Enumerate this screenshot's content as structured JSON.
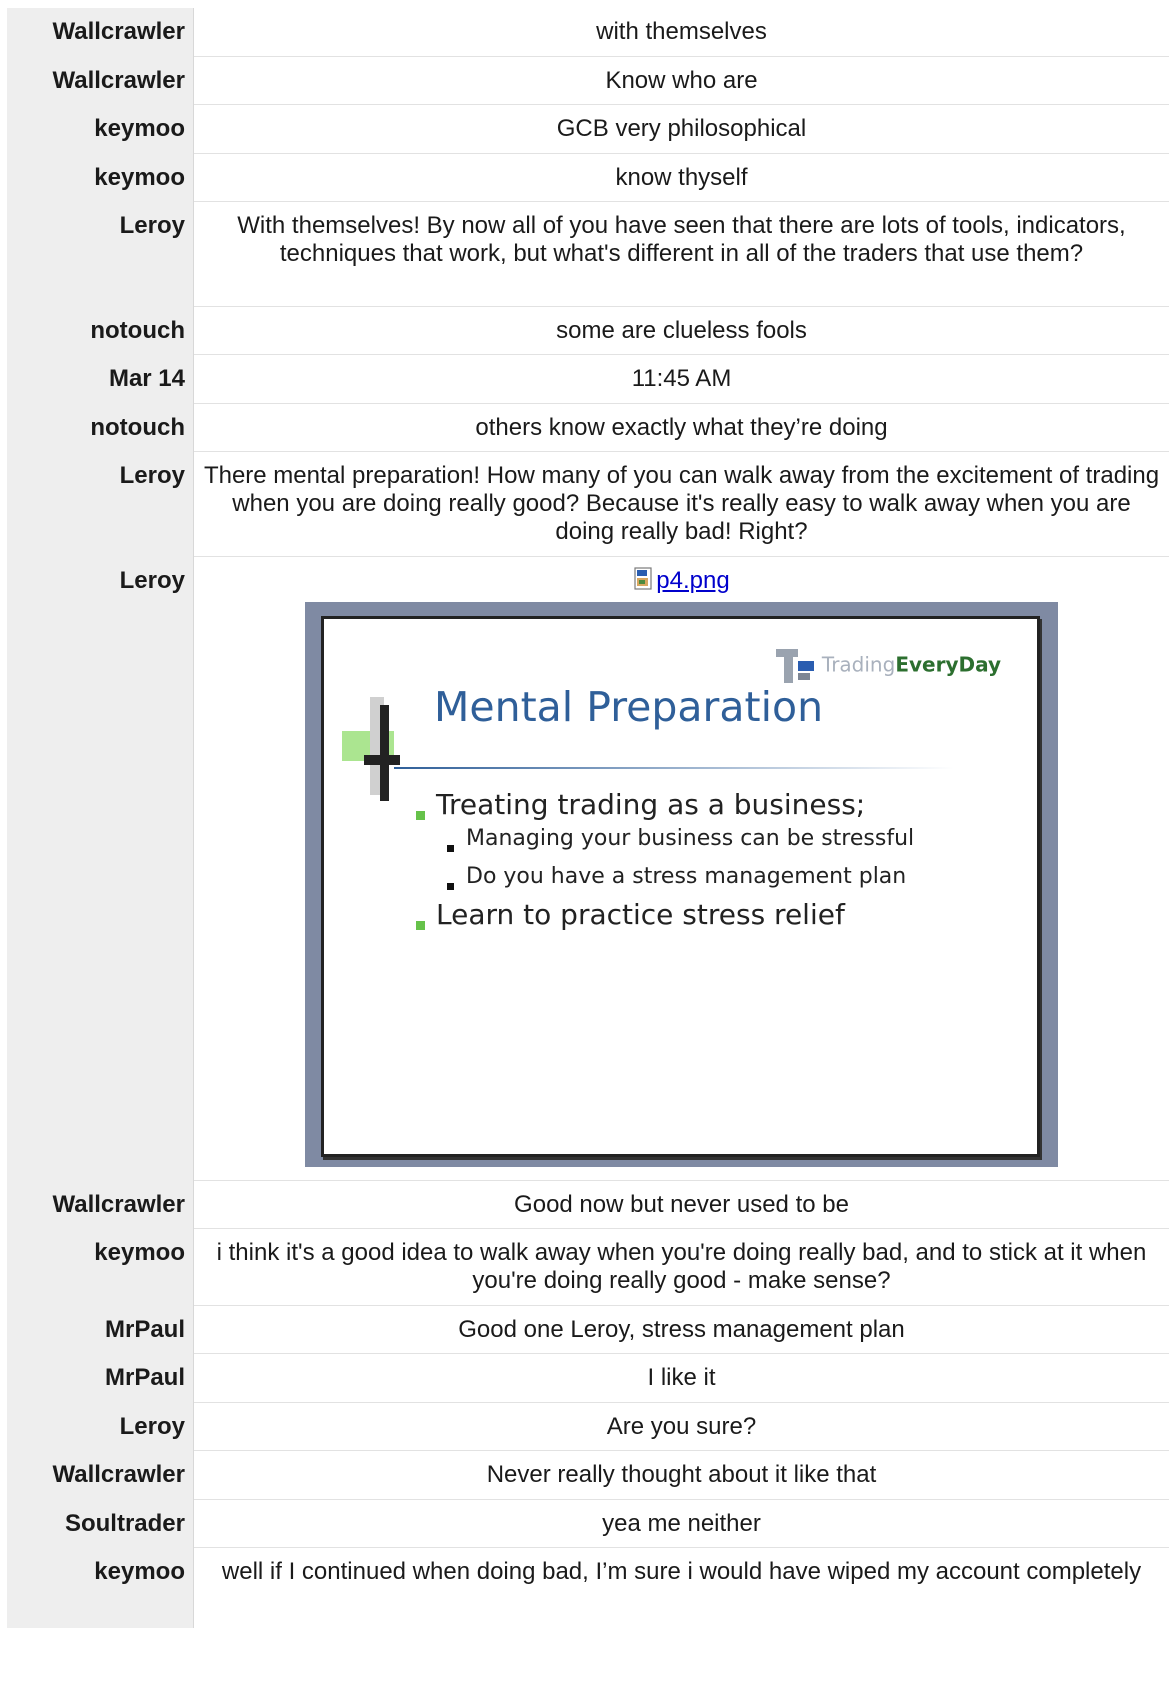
{
  "rows": [
    {
      "user": "Wallcrawler",
      "text": "with themselves"
    },
    {
      "user": "Wallcrawler",
      "text": "Know who are"
    },
    {
      "user": "keymoo",
      "text": "GCB very philosophical"
    },
    {
      "user": "keymoo",
      "text": "know thyself"
    },
    {
      "user": "Leroy",
      "text": "With themselves! By now all of you have seen that there are lots of tools, indicators, techniques that work, but what's different in all of the traders that use them?"
    },
    {
      "user": "notouch",
      "text": "some are clueless fools"
    },
    {
      "user": "Mar 14",
      "text": "11:45 AM"
    },
    {
      "user": "notouch",
      "text": "others know exactly what they’re doing"
    },
    {
      "user": "Leroy",
      "text": "There mental preparation! How many of you can walk away from the excitement of trading when you are doing really good? Because it's really easy to walk away when you are doing really bad! Right?"
    },
    {
      "user": "Leroy",
      "attachment": "p4.png"
    },
    {
      "user": "Wallcrawler",
      "text": "Good now but never used to be"
    },
    {
      "user": "keymoo",
      "text": "i think it's a good idea to walk away when you're doing really bad, and to stick at it when you're doing really good - make sense?"
    },
    {
      "user": "MrPaul",
      "text": "Good one Leroy, stress management plan"
    },
    {
      "user": "MrPaul",
      "text": "I like it"
    },
    {
      "user": "Leroy",
      "text": "Are you sure?"
    },
    {
      "user": "Wallcrawler",
      "text": "Never really thought about it like that"
    },
    {
      "user": "Soultrader",
      "text": "yea me neither"
    },
    {
      "user": "keymoo",
      "text": "well if I continued when doing bad, I’m sure i would have wiped my account completely"
    }
  ],
  "slide": {
    "logo_light": "Trading",
    "logo_bold": "EveryDay",
    "title": "Mental Preparation",
    "bullet1": "Treating trading as a business;",
    "sub1": "Managing your business can be stressful",
    "sub2": "Do you have a stress management plan",
    "bullet2": "Learn to practice stress relief"
  },
  "icons": {
    "attachment": "image-file-icon",
    "link_color": "#0000cc"
  }
}
